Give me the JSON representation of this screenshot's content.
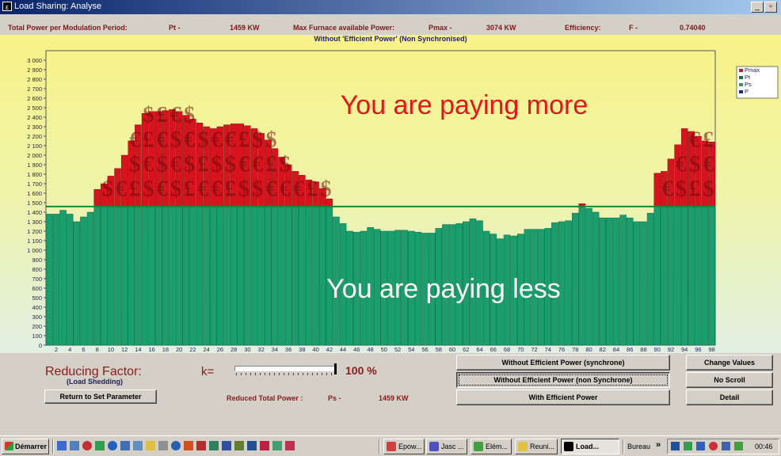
{
  "window": {
    "title": "Load Sharing: Analyse",
    "minimize": "_",
    "maximize": "▫"
  },
  "info": {
    "pt_label": "Total Power per Modulation Period:",
    "pt_symbol": "Pt -",
    "pt_value": "1459 KW",
    "pmax_label": "Max Furnace available Power:",
    "pmax_symbol": "Pmax -",
    "pmax_value": "3074 KW",
    "eff_label": "Efficiency:",
    "eff_symbol": "F -",
    "eff_value": "0.74040"
  },
  "chart_data": {
    "type": "bar",
    "title": "Without 'Efficient Power' (Non Synchronised)",
    "x": [
      1,
      2,
      3,
      4,
      5,
      6,
      7,
      8,
      9,
      10,
      11,
      12,
      13,
      14,
      15,
      16,
      17,
      18,
      19,
      20,
      21,
      22,
      23,
      24,
      25,
      26,
      27,
      28,
      29,
      30,
      31,
      32,
      33,
      34,
      35,
      36,
      37,
      38,
      39,
      40,
      41,
      42,
      43,
      44,
      45,
      46,
      47,
      48,
      49,
      50,
      51,
      52,
      53,
      54,
      55,
      56,
      57,
      58,
      59,
      60,
      61,
      62,
      63,
      64,
      65,
      66,
      67,
      68,
      69,
      70,
      71,
      72,
      73,
      74,
      75,
      76,
      76,
      78,
      79,
      80,
      81,
      82,
      83,
      84,
      85,
      86,
      87,
      88,
      89,
      90,
      91,
      92,
      93,
      94,
      95,
      96,
      97,
      98
    ],
    "xticks": [
      "2",
      "4",
      "6",
      "8",
      "10",
      "12",
      "14",
      "16",
      "18",
      "20",
      "22",
      "24",
      "26",
      "28",
      "30",
      "32",
      "34",
      "36",
      "38",
      "40",
      "42",
      "44",
      "46",
      "48",
      "50",
      "52",
      "54",
      "56",
      "58",
      "60",
      "62",
      "64",
      "66",
      "68",
      "70",
      "72",
      "74",
      "76",
      "78",
      "80",
      "82",
      "84",
      "86",
      "88",
      "90",
      "92",
      "94",
      "96",
      "98"
    ],
    "yticks": [
      "0",
      "100",
      "200",
      "300",
      "400",
      "500",
      "600",
      "700",
      "800",
      "900",
      "1 000",
      "1 100",
      "1 200",
      "1 300",
      "1 400",
      "1 500",
      "1 600",
      "1 700",
      "1 800",
      "1 900",
      "2 000",
      "2 100",
      "2 200",
      "2 300",
      "2 400",
      "2 500",
      "2 600",
      "2 700",
      "2 800",
      "2 900",
      "3 000"
    ],
    "ylim": [
      0,
      3100
    ],
    "threshold": 1459,
    "series": [
      {
        "name": "P",
        "values": [
          1380,
          1380,
          1420,
          1380,
          1300,
          1350,
          1400,
          1640,
          1700,
          1780,
          1860,
          2000,
          2150,
          2320,
          2440,
          2460,
          2460,
          2470,
          2480,
          2460,
          2420,
          2380,
          2340,
          2300,
          2280,
          2300,
          2320,
          2330,
          2330,
          2310,
          2280,
          2230,
          2160,
          2070,
          1980,
          1900,
          1830,
          1790,
          1740,
          1720,
          1650,
          1540,
          1350,
          1280,
          1200,
          1190,
          1200,
          1240,
          1220,
          1200,
          1200,
          1210,
          1210,
          1200,
          1190,
          1180,
          1180,
          1230,
          1270,
          1270,
          1280,
          1300,
          1330,
          1310,
          1200,
          1170,
          1120,
          1160,
          1150,
          1170,
          1220,
          1220,
          1220,
          1230,
          1290,
          1300,
          1310,
          1390,
          1490,
          1440,
          1400,
          1340,
          1340,
          1340,
          1370,
          1340,
          1300,
          1300,
          1390,
          1810,
          1830,
          1960,
          2110,
          2280,
          2250,
          2200,
          2150,
          2140
        ]
      }
    ],
    "legend": [
      "Pmax",
      "Pt",
      "Ps",
      "P"
    ],
    "legend_colors": [
      "#e0102a",
      "#0a7a35",
      "#2aa060",
      "#1b2f8a"
    ],
    "bar_color": "#1b9e6e",
    "excess_color": "#d9131e",
    "line_color": "#0f8a3a",
    "annotations": {
      "more": "You are paying more",
      "less": "You are paying less"
    }
  },
  "controls": {
    "reducing_label": "Reducing Factor:",
    "reducing_sub": "(Load Shedding)",
    "k_label": "k=",
    "k_value": "100 %",
    "slider_level": 1.0,
    "return_button": "Return to Set Parameter",
    "reduced_label": "Reduced Total Power :",
    "reduced_symbol": "Ps -",
    "reduced_value": "1459 KW",
    "btn_sync": "Without Efficient Power (synchrone)",
    "btn_nonsync": "Without Efficient Power (non Synchrone)",
    "btn_efficient": "With Efficient Power",
    "btn_change": "Change Values",
    "btn_noscroll": "No Scroll",
    "btn_detail": "Detail"
  },
  "taskbar": {
    "start": "Démarrer",
    "tasks": [
      "Epow...",
      "Jasc ...",
      "Elém...",
      "Reuni...",
      "Load..."
    ],
    "bureau": "Bureau",
    "chevron": "»",
    "clock": "00:46"
  }
}
